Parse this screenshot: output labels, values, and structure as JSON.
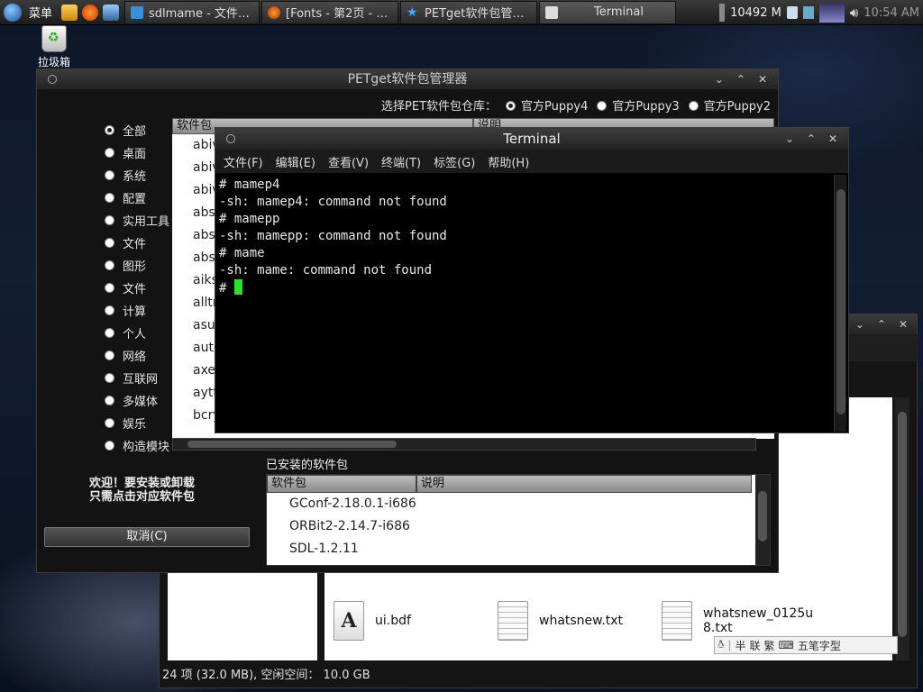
{
  "taskbar": {
    "menu_label": "菜单",
    "tasks": [
      {
        "label": "sdlmame - 文件…",
        "icon": "folder-icon"
      },
      {
        "label": "[Fonts - 第2页 - …",
        "icon": "firefox-icon"
      },
      {
        "label": "PETget软件包管…",
        "icon": "star-icon"
      },
      {
        "label": "Terminal",
        "icon": "terminal-icon"
      }
    ],
    "memory": "10492 M",
    "clock": "10:54 AM"
  },
  "desktop": {
    "trash_label": "拉圾箱"
  },
  "petget": {
    "title": "PETget软件包管理器",
    "repo_prompt": "选择PET软件包仓库：",
    "repos": [
      {
        "label": "官方Puppy4",
        "selected": true
      },
      {
        "label": "官方Puppy3",
        "selected": false
      },
      {
        "label": "官方Puppy2",
        "selected": false
      }
    ],
    "categories": [
      "全部",
      "桌面",
      "系统",
      "配置",
      "实用工具",
      "文件",
      "图形",
      "文件",
      "计算",
      "个人",
      "网络",
      "互联网",
      "多媒体",
      "娱乐",
      "构造模块"
    ],
    "list_header": {
      "package": "软件包",
      "description": "说明"
    },
    "packages": [
      "abiv",
      "abiv",
      "abiv",
      "abs",
      "abs",
      "abs",
      "aiks",
      "alltr",
      "asu",
      "auto",
      "axe",
      "aytt",
      "bcry"
    ],
    "welcome_line1": "欢迎！要安装或卸载",
    "welcome_line2": "只需点击对应软件包",
    "cancel_label": "取消(C)",
    "installed_label": "已安装的软件包",
    "installed_header": {
      "package": "软件包",
      "description": "说明"
    },
    "installed": [
      "GConf-2.18.0.1-i686",
      "ORBit2-2.14.7-i686",
      "SDL-1.2.11"
    ]
  },
  "terminal": {
    "title": "Terminal",
    "menus": [
      "文件(F)",
      "编辑(E)",
      "查看(V)",
      "终端(T)",
      "标签(G)",
      "帮助(H)"
    ],
    "lines": [
      "# mamep4",
      "-sh: mamep4: command not found",
      "# mamepp",
      "-sh: mamepp: command not found",
      "# mame",
      "-sh: mame: command not found"
    ],
    "prompt": "# "
  },
  "filemanager": {
    "files": [
      {
        "name": "ui.bdf",
        "icon": "font-file-icon",
        "glyph": "A"
      },
      {
        "name": "whatsnew.txt",
        "icon": "text-file-icon",
        "glyph": ""
      },
      {
        "name": "whatsnew_0125u8.txt",
        "icon": "text-file-icon",
        "glyph": ""
      }
    ],
    "status": "24 项 (32.0 MB), 空闲空间： 10.0 GB"
  },
  "ime": {
    "labels": [
      "半",
      "联",
      "繁"
    ],
    "name": "五笔字型"
  }
}
